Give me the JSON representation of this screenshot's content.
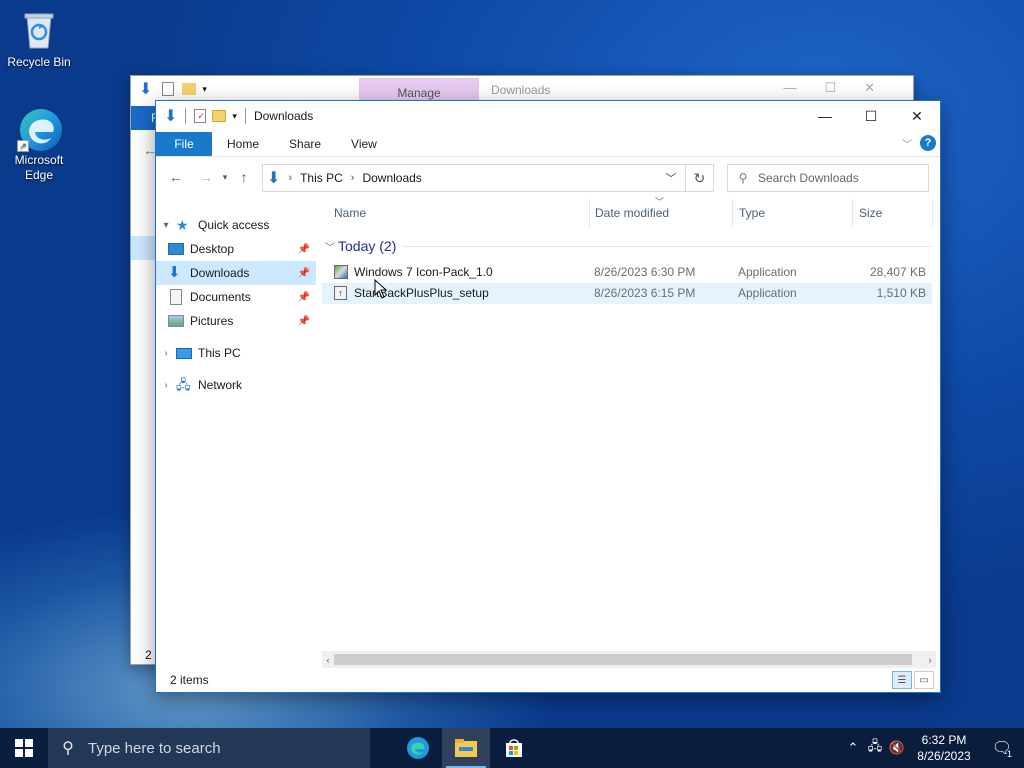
{
  "desktop": {
    "icons": [
      {
        "label": "Recycle Bin"
      },
      {
        "label": "Microsoft Edge"
      }
    ]
  },
  "back_window": {
    "manage_tab": "Manage",
    "title": "Downloads",
    "file_tab": "F"
  },
  "window": {
    "title": "Downloads",
    "ribbon_tabs": [
      "File",
      "Home",
      "Share",
      "View"
    ],
    "address": {
      "crumbs": [
        "This PC",
        "Downloads"
      ]
    },
    "search_placeholder": "Search Downloads",
    "nav": {
      "quick_access": "Quick access",
      "items": [
        {
          "label": "Desktop",
          "icon": "desktop-icon",
          "pinned": true
        },
        {
          "label": "Downloads",
          "icon": "downloads-icon",
          "pinned": true,
          "selected": true
        },
        {
          "label": "Documents",
          "icon": "documents-icon",
          "pinned": true
        },
        {
          "label": "Pictures",
          "icon": "pictures-icon",
          "pinned": true
        }
      ],
      "this_pc": "This PC",
      "network": "Network"
    },
    "columns": {
      "name": "Name",
      "date_modified": "Date modified",
      "type": "Type",
      "size": "Size"
    },
    "group_label": "Today (2)",
    "files": [
      {
        "name": "Windows 7 Icon-Pack_1.0",
        "date": "8/26/2023 6:30 PM",
        "type": "Application",
        "size": "28,407 KB"
      },
      {
        "name": "StartBackPlusPlus_setup",
        "date": "8/26/2023 6:15 PM",
        "type": "Application",
        "size": "1,510 KB"
      }
    ],
    "status": "2 items"
  },
  "taskbar": {
    "search_placeholder": "Type here to search",
    "time": "6:32 PM",
    "date": "8/26/2023",
    "notification_count": "1"
  }
}
